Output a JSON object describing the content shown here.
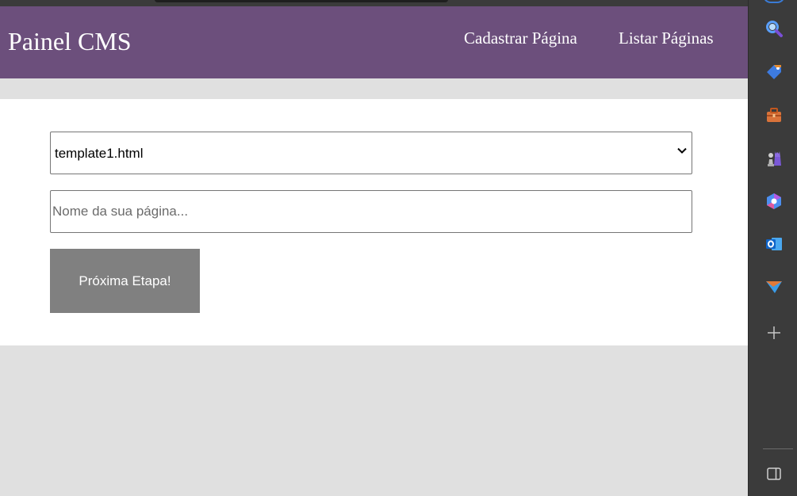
{
  "site": {
    "brand": "Painel CMS",
    "nav": [
      "Cadastrar Página",
      "Listar Páginas"
    ]
  },
  "form": {
    "template_select": {
      "selected": "template1.html"
    },
    "page_name": {
      "value": "",
      "placeholder": "Nome da sua página..."
    },
    "submit_label": "Próxima Etapa!"
  },
  "colors": {
    "header": "#6c4f7c",
    "button": "#808080",
    "background": "#e0e0e0"
  },
  "sidebar": {
    "icons": [
      "search-icon",
      "tag-icon",
      "toolbox-icon",
      "chess-icon",
      "copilot-icon",
      "outlook-icon",
      "send-icon",
      "add-icon",
      "sidebar-toggle-icon"
    ]
  }
}
